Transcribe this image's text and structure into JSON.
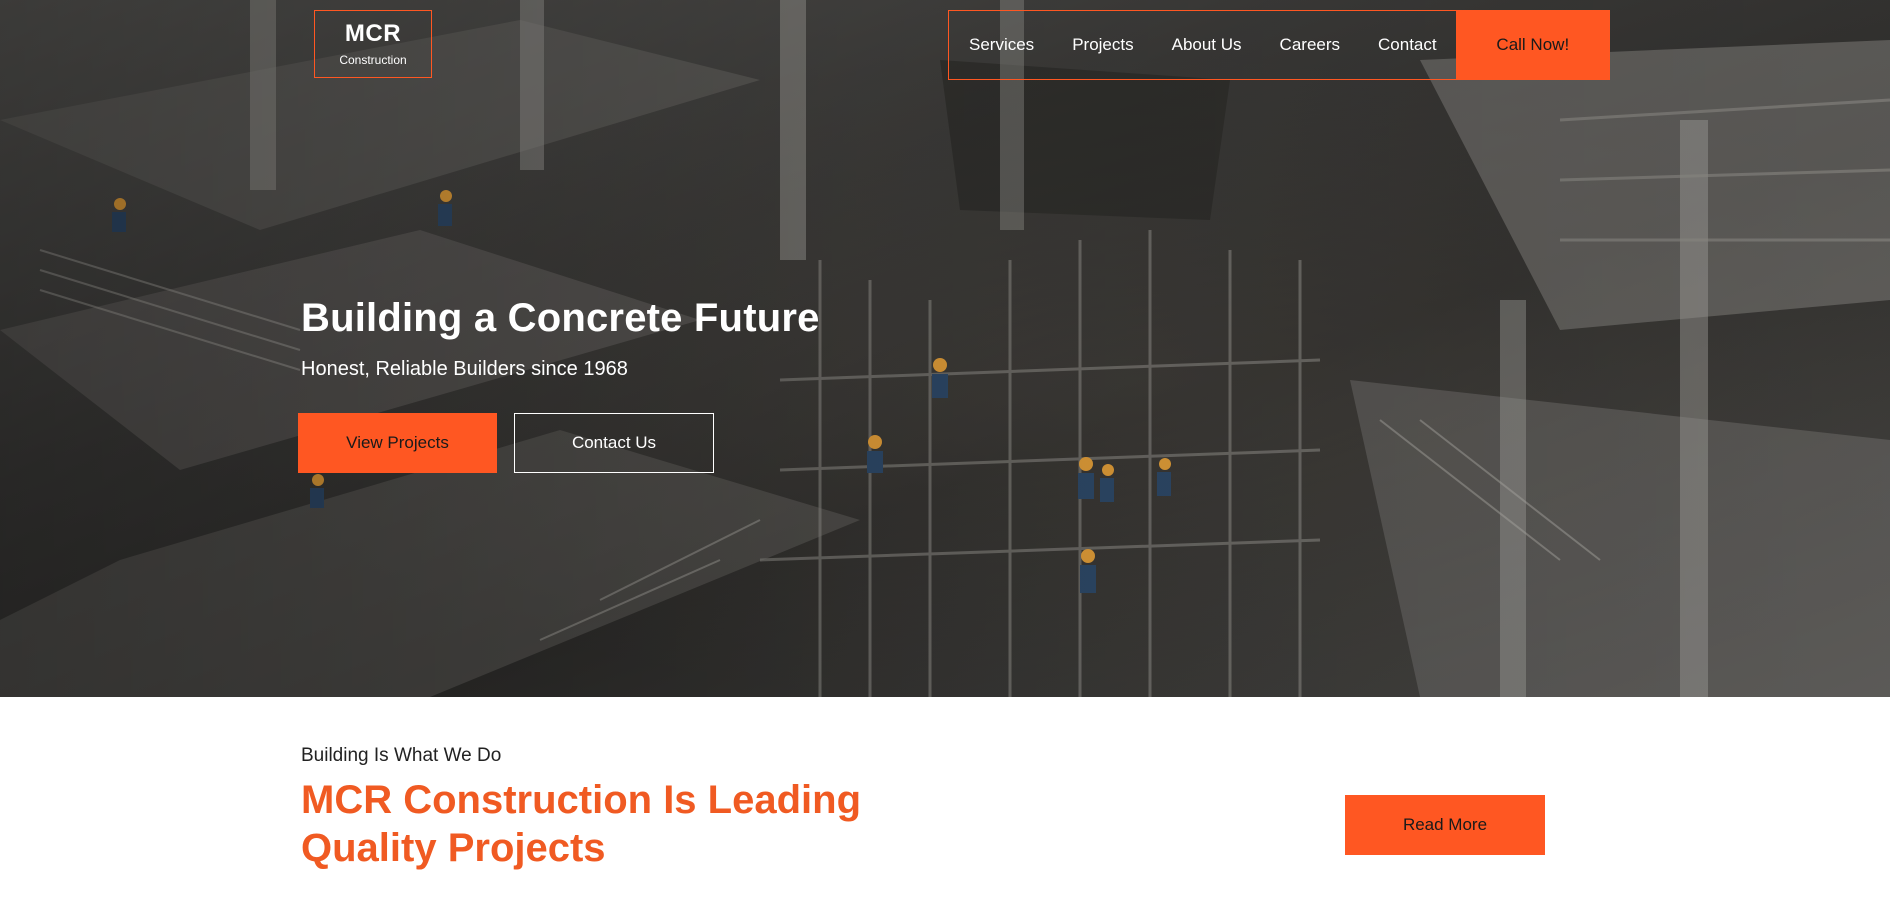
{
  "brand": {
    "title": "MCR",
    "subtitle": "Construction"
  },
  "nav": {
    "links": [
      "Services",
      "Projects",
      "About Us",
      "Careers",
      "Contact"
    ],
    "cta": "Call Now!"
  },
  "hero": {
    "title": "Building a Concrete Future",
    "subtitle": "Honest, Reliable Builders since 1968",
    "primary_button": "View Projects",
    "secondary_button": "Contact Us"
  },
  "about": {
    "eyebrow": "Building Is What We Do",
    "title": "MCR Construction Is Leading Quality Projects",
    "button": "Read More"
  },
  "colors": {
    "accent": "#ff5722",
    "heading_accent": "#f05a22"
  }
}
